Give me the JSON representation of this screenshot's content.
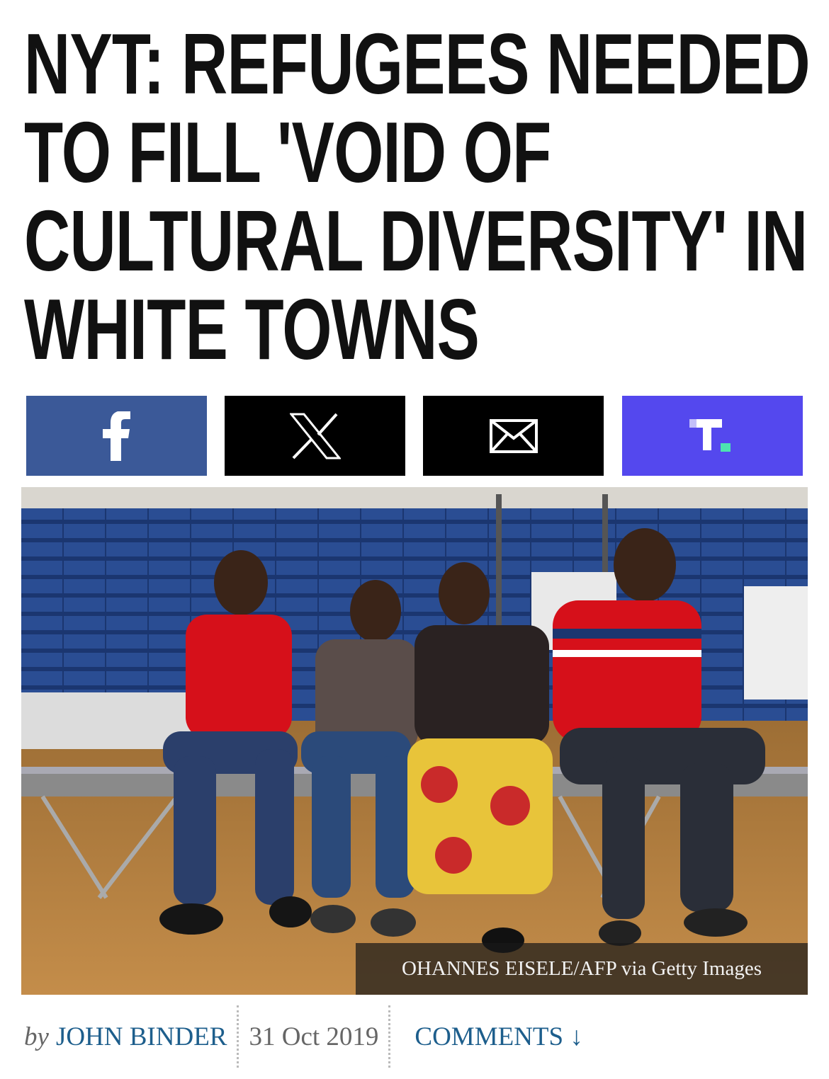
{
  "article": {
    "headline_lines": [
      "NYT: REFUGEES NEEDED",
      "TO FILL 'VOID OF",
      "CULTURAL DIVERSITY' IN",
      "WHITE TOWNS"
    ],
    "share_buttons": [
      {
        "network": "facebook",
        "icon": "facebook-icon",
        "color": "#3b5998"
      },
      {
        "network": "x",
        "icon": "x-icon",
        "color": "#000000"
      },
      {
        "network": "email",
        "icon": "mail-icon",
        "color": "#000000"
      },
      {
        "network": "truth-social",
        "icon": "truth-social-icon",
        "color": "#5448ee"
      }
    ],
    "photo": {
      "credit": "OHANNES EISELE/AFP via Getty Images"
    },
    "byline": {
      "by": "by",
      "author": "JOHN BINDER",
      "date": "31 Oct 2019",
      "comments": "COMMENTS ↓"
    }
  }
}
